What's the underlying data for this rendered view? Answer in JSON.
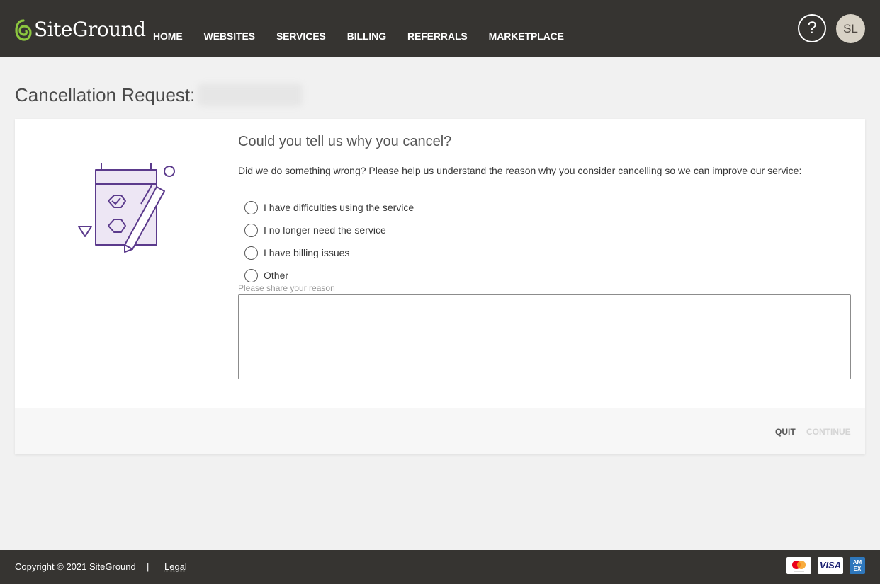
{
  "header": {
    "logo_text": "SiteGround",
    "nav": [
      "HOME",
      "WEBSITES",
      "SERVICES",
      "BILLING",
      "REFERRALS",
      "MARKETPLACE"
    ],
    "help_label": "?",
    "avatar_initials": "SL"
  },
  "page": {
    "title": "Cancellation Request:"
  },
  "form": {
    "question": "Could you tell us why you cancel?",
    "description": "Did we do something wrong? Please help us understand the reason why you consider cancelling so we can improve our service:",
    "options": [
      "I have difficulties using the service",
      "I no longer need the service",
      "I have billing issues",
      "Other"
    ],
    "reason_label": "Please share your reason",
    "reason_value": ""
  },
  "actions": {
    "quit_label": "QUIT",
    "continue_label": "CONTINUE"
  },
  "footer": {
    "copyright": "Copyright © 2021 SiteGround",
    "separator": "|",
    "legal": "Legal",
    "visa_label": "VISA",
    "amex_label": "AM EX"
  },
  "colors": {
    "header_bg": "#363431",
    "logo_green": "#8cc63f",
    "illustration_purple": "#5b3a8c",
    "illustration_fill": "#ede6f4"
  }
}
